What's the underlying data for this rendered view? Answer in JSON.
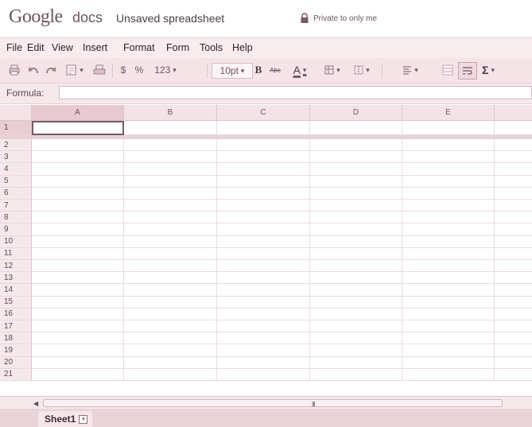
{
  "app": {
    "logo": "Google",
    "product": "docs",
    "doc_title": "Unsaved spreadsheet",
    "privacy": "Private to only me"
  },
  "menu": [
    "File",
    "Edit",
    "View",
    "Insert",
    "Format",
    "Form",
    "Tools",
    "Help"
  ],
  "toolbar": {
    "icons": [
      "print-icon",
      "undo-icon",
      "redo-icon",
      "paint-format-icon",
      "print-preview-icon"
    ],
    "currency": "$",
    "percent": "%",
    "number_format": "123",
    "font_size": "10pt",
    "bold": "B",
    "strikethrough": "Abc",
    "text_color": "A",
    "sigma": "Σ"
  },
  "formula": {
    "label": "Formula:",
    "value": ""
  },
  "grid": {
    "columns": [
      "A",
      "B",
      "C",
      "D",
      "E"
    ],
    "rows": [
      "1",
      "2",
      "3",
      "4",
      "5",
      "6",
      "7",
      "8",
      "9",
      "10",
      "11",
      "12",
      "13",
      "14",
      "15",
      "16",
      "17",
      "18",
      "19",
      "20",
      "21"
    ],
    "selected_cell": "A1"
  },
  "sheets": [
    "Sheet1"
  ],
  "colors": {
    "accent": "#e8c9d1",
    "toolbar_bg": "#f4e4e8",
    "text": "#222222"
  }
}
